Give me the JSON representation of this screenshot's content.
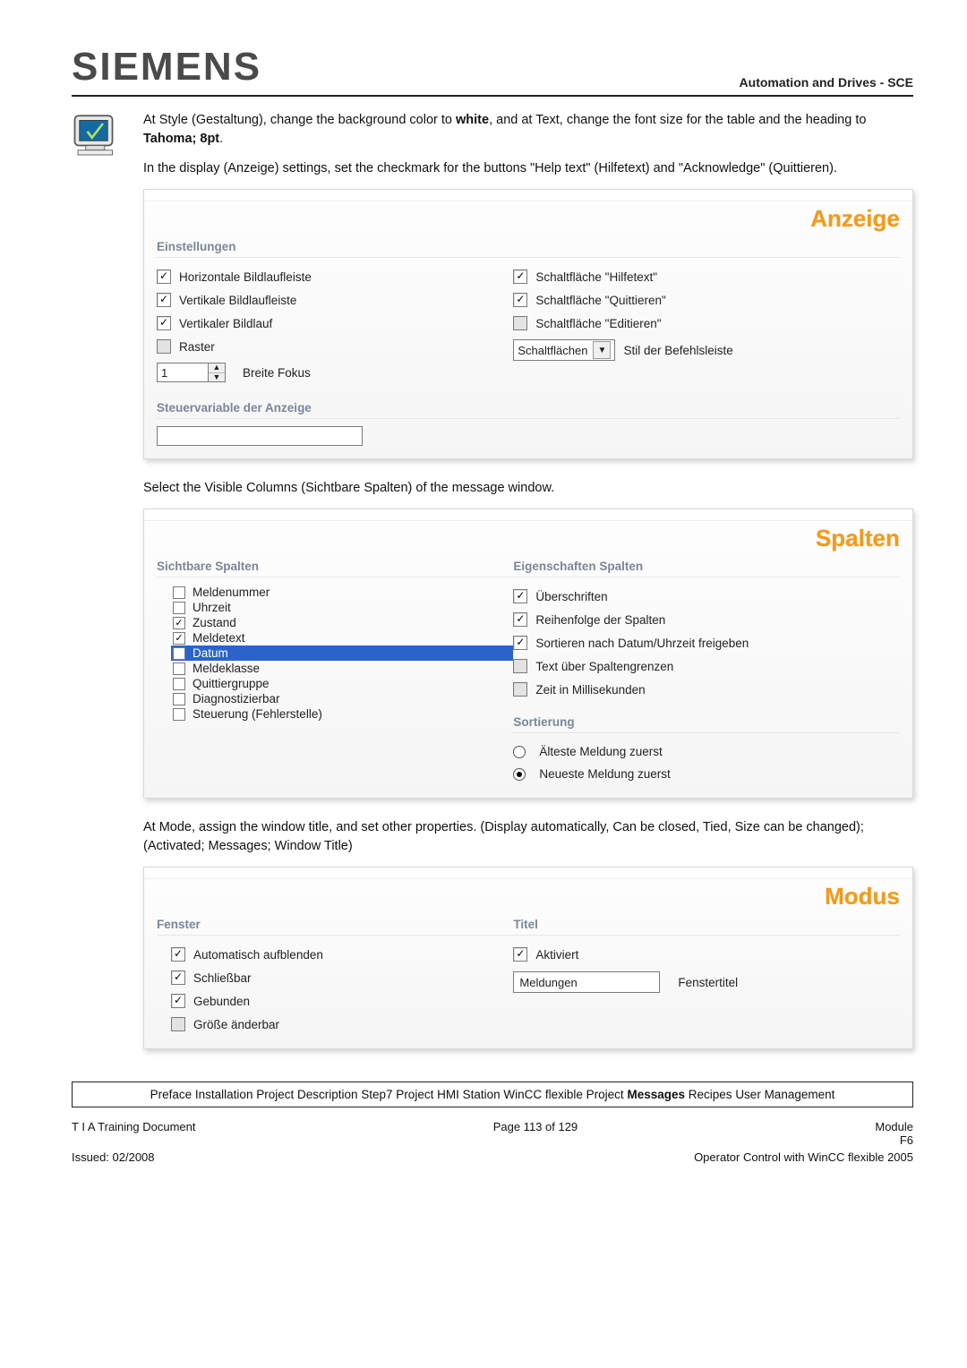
{
  "brand": "SIEMENS",
  "header_right": "Automation and Drives - SCE",
  "para1": {
    "a": "At Style (Gestaltung), change the background color to ",
    "b": "white",
    "c": ", and at Text, change the font size for the table and the heading to ",
    "d": "Tahoma; 8pt",
    "e": "."
  },
  "para2": "In the display (Anzeige) settings, set the checkmark for the buttons \"Help text\" (Hilfetext) and \"Acknowledge\" (Quittieren).",
  "anzeige": {
    "title": "Anzeige",
    "section1": "Einstellungen",
    "left": {
      "horiz": "Horizontale Bildlaufleiste",
      "vert": "Vertikale Bildlaufleiste",
      "vert_scroll": "Vertikaler Bildlauf",
      "raster": "Raster",
      "focus_label": "Breite Fokus",
      "focus_val": "1"
    },
    "right": {
      "hilfetext": "Schaltfläche \"Hilfetext\"",
      "quittieren": "Schaltfläche \"Quittieren\"",
      "editieren": "Schaltfläche \"Editieren\"",
      "style_select": "Schaltflächen",
      "style_label": "Stil der Befehlsleiste"
    },
    "section2": "Steuervariable der Anzeige"
  },
  "para3": "Select the Visible Columns (Sichtbare Spalten) of the message window.",
  "spalten": {
    "title": "Spalten",
    "sec_sicht": "Sichtbare Spalten",
    "sec_eigen": "Eigenschaften Spalten",
    "sec_sort": "Sortierung",
    "list": {
      "meldenummer": "Meldenummer",
      "uhrzeit": "Uhrzeit",
      "zustand": "Zustand",
      "meldetext": "Meldetext",
      "datum": "Datum",
      "meldeklasse": "Meldeklasse",
      "quittier": "Quittiergruppe",
      "diag": "Diagnostizierbar",
      "steuer": "Steuerung (Fehlerstelle)"
    },
    "eigen": {
      "ueber": "Überschriften",
      "reihen": "Reihenfolge der Spalten",
      "sort_date": "Sortieren nach Datum/Uhrzeit freigeben",
      "text_ueber": "Text über Spaltengrenzen",
      "zeit_ms": "Zeit in Millisekunden"
    },
    "sort": {
      "old": "Älteste Meldung zuerst",
      "new": "Neueste Meldung zuerst"
    }
  },
  "para4": "At Mode, assign the window title, and set other properties. (Display automatically, Can be closed, Tied, Size can be changed); (Activated; Messages; Window Title)",
  "modus": {
    "title": "Modus",
    "sec_fenster": "Fenster",
    "sec_titel": "Titel",
    "fenster": {
      "auto": "Automatisch aufblenden",
      "close": "Schließbar",
      "bound": "Gebunden",
      "resize": "Größe änderbar"
    },
    "titel": {
      "aktiviert": "Aktiviert",
      "input_val": "Meldungen",
      "input_label": "Fenstertitel"
    }
  },
  "breadcrumbs": {
    "preface": "Preface",
    "install": "Installation",
    "proj": "Project Description",
    "step7": "Step7 Project",
    "hmi": "HMI Station",
    "wincc": "WinCC flexible Project",
    "messages": "Messages",
    "recipes": "Recipes",
    "user": "User Management"
  },
  "footer": {
    "left1": "T I A  Training Document",
    "center1": "Page 113 of 129",
    "right1": "Module",
    "right2": "F6",
    "left2": "Issued: 02/2008",
    "right3": "Operator Control with WinCC flexible 2005"
  }
}
